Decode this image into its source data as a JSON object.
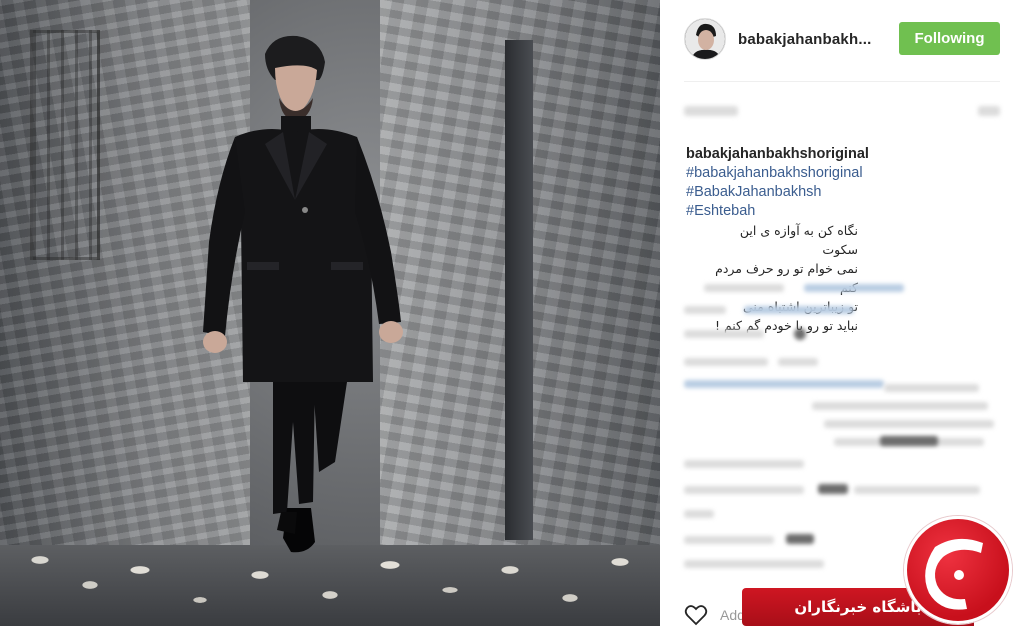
{
  "post": {
    "username": "babakjahanbakh...",
    "follow_label": "Following",
    "caption_user": "babakjahanbakhshoriginal",
    "caption_tag_1": "#babakjahan",
    "caption_tag_1b": "bakhshoriginal",
    "caption_tag_2": "#BabakJahanbakhsh",
    "caption_tag_3": "#Eshtebah",
    "lyrics": [
      "نگاه کن به آوازه ی این سکوت",
      "نمی خوام تو رو حرف مردم کنم",
      "تو زیباترین اشتباه منی",
      "نباید تو رو با خودم گم کنم !"
    ],
    "add_comment_label": "Add"
  },
  "watermark": {
    "band_text": "باشگاه خبرنگاران",
    "logo_glyph": "ج"
  },
  "colors": {
    "follow_green": "#70c050",
    "hashtag_blue": "#3b5d8f",
    "watermark_red": "#c8101c"
  },
  "icons": [
    "heart-icon",
    "avatar"
  ]
}
